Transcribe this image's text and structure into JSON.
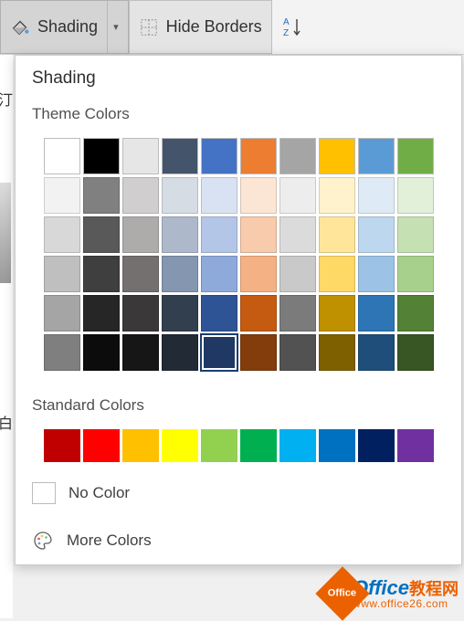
{
  "ribbon": {
    "shading_label": "Shading",
    "hide_borders_label": "Hide Borders",
    "sort_label": "A↓Z"
  },
  "flyout": {
    "title": "Shading",
    "theme_label": "Theme Colors",
    "standard_label": "Standard Colors",
    "no_color_label": "No Color",
    "more_colors_label": "More Colors"
  },
  "theme_colors": {
    "row0": [
      "#FFFFFF",
      "#000000",
      "#E7E6E6",
      "#44546A",
      "#4472C4",
      "#ED7D31",
      "#A5A5A5",
      "#FFC000",
      "#5B9BD5",
      "#70AD47"
    ],
    "row1": [
      "#F2F2F2",
      "#808080",
      "#D0CECE",
      "#D6DCE4",
      "#D9E2F3",
      "#FBE5D5",
      "#EDEDED",
      "#FFF2CC",
      "#DEEBF6",
      "#E2EFD9"
    ],
    "row2": [
      "#D8D8D8",
      "#595959",
      "#AEABAB",
      "#ADB9CA",
      "#B4C6E7",
      "#F7CBAC",
      "#DBDBDB",
      "#FEE599",
      "#BDD7EE",
      "#C5E0B3"
    ],
    "row3": [
      "#BFBFBF",
      "#3F3F3F",
      "#757070",
      "#8496B0",
      "#8EAADB",
      "#F4B183",
      "#C9C9C9",
      "#FFD965",
      "#9CC3E5",
      "#A8D08D"
    ],
    "row4": [
      "#A5A5A5",
      "#262626",
      "#3A3838",
      "#323F4F",
      "#2F5496",
      "#C55A11",
      "#7B7B7B",
      "#BF9000",
      "#2E75B5",
      "#538135"
    ],
    "row5": [
      "#7F7F7F",
      "#0C0C0C",
      "#171616",
      "#222A35",
      "#1F3864",
      "#833C0B",
      "#525252",
      "#7F6000",
      "#1E4E79",
      "#375623"
    ]
  },
  "selected_theme": {
    "row": 5,
    "col": 4
  },
  "standard_colors": [
    "#C00000",
    "#FF0000",
    "#FFC000",
    "#FFFF00",
    "#92D050",
    "#00B050",
    "#00B0F0",
    "#0070C0",
    "#002060",
    "#7030A0"
  ],
  "watermark": {
    "brand": "Office",
    "suffix": "教程网",
    "url": "www.office26.com"
  },
  "doc_hints": {
    "char1": "汀",
    "char2": "白"
  }
}
